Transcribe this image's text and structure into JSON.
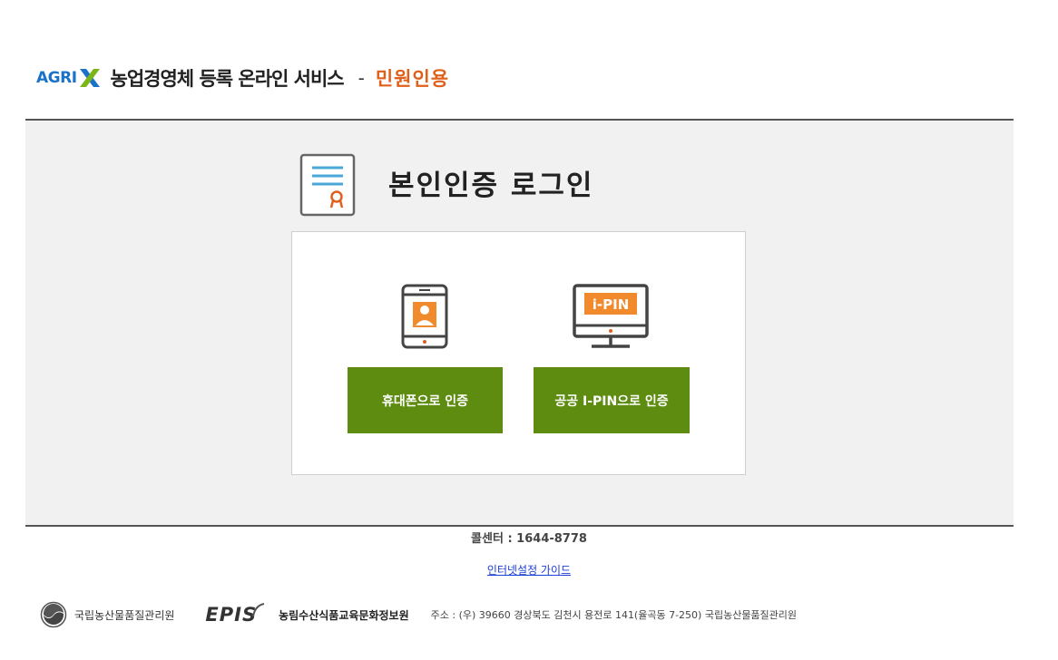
{
  "header": {
    "logo_agri": "AGRI",
    "logo_x": "X",
    "service_title": "농업경영체 등록 온라인 서비스",
    "dash": "-",
    "sub_title": "민원인용"
  },
  "login": {
    "title": "본인인증 로그인",
    "phone_button": "휴대폰으로 인증",
    "ipin_button": "공공 I-PIN으로 인증",
    "ipin_screen_text": "i-PIN"
  },
  "footer": {
    "call_center": "콜센터 : 1644-8778",
    "guide_link": "인터넷설정 가이드",
    "org1_name": "국립농산물품질관리원",
    "org2_logo": "EPIS",
    "org2_name": "농림수산식품교육문화정보원",
    "address": "주소 : (우) 39660 경상북도 김천시 용전로 141(율곡동 7-250) 국립농산물품질관리원"
  },
  "colors": {
    "brand_blue": "#1a73c9",
    "accent_orange": "#e0601b",
    "button_green": "#5e8c10",
    "panel_bg": "#f1f1f1"
  }
}
